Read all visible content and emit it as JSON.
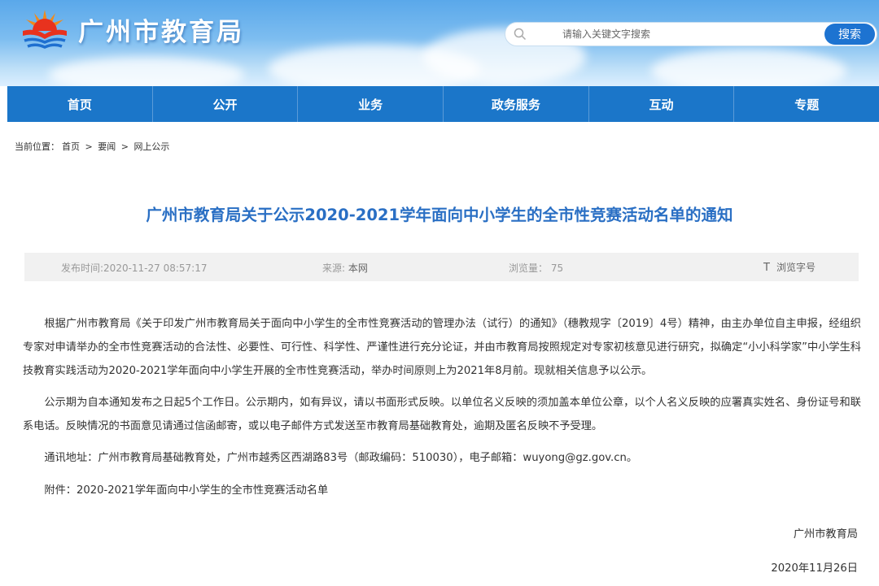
{
  "site": {
    "title": "广州市教育局"
  },
  "search": {
    "placeholder": "请输入关键文字搜索",
    "button_label": "搜索"
  },
  "nav": {
    "items": [
      "首页",
      "公开",
      "业务",
      "政务服务",
      "互动",
      "专题"
    ]
  },
  "breadcrumb": {
    "prefix": "当前位置：",
    "items": [
      "首页",
      "要闻",
      "网上公示"
    ],
    "separator": ">"
  },
  "article": {
    "title": "广州市教育局关于公示2020-2021学年面向中小学生的全市性竞赛活动名单的通知",
    "meta": {
      "publish_time": "发布时间:2020-11-27 08:57:17",
      "source_label": "来源: ",
      "source_value": "本网",
      "views_label": "浏览量：",
      "views_value": "75",
      "font_icon": "T",
      "font_label": "浏览字号"
    },
    "paragraphs": [
      "根据广州市教育局《关于印发广州市教育局关于面向中小学生的全市性竞赛活动的管理办法（试行）的通知》（穗教规字〔2019〕4号）精神，由主办单位自主申报，经组织专家对申请举办的全市性竞赛活动的合法性、必要性、可行性、科学性、严谨性进行充分论证，并由市教育局按照规定对专家初核意见进行研究，拟确定“小小科学家”中小学生科技教育实践活动为2020-2021学年面向中小学生开展的全市性竞赛活动，举办时间原则上为2021年8月前。现就相关信息予以公示。",
      "公示期为自本通知发布之日起5个工作日。公示期内，如有异议，请以书面形式反映。以单位名义反映的须加盖本单位公章，以个人名义反映的应署真实姓名、身份证号和联系电话。反映情况的书面意见请通过信函邮寄，或以电子邮件方式发送至市教育局基础教育处，逾期及匿名反映不予受理。",
      "通讯地址：广州市教育局基础教育处，广州市越秀区西湖路83号（邮政编码：510030），电子邮箱：wuyong@gz.gov.cn。",
      "附件：2020-2021学年面向中小学生的全市性竞赛活动名单"
    ],
    "signature": "广州市教育局",
    "date": "2020年11月26日"
  },
  "colors": {
    "nav_bg": "#1b76c9",
    "title": "#2a6fc4",
    "search_button": "#1d73d1"
  },
  "icons": {
    "logo": "education-bureau-emblem-icon",
    "search": "search-icon",
    "font_size": "font-size-icon"
  }
}
